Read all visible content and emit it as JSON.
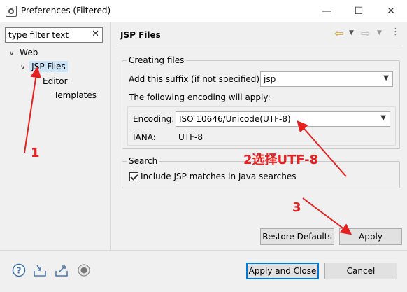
{
  "window": {
    "title": "Preferences (Filtered)",
    "minimize_glyph": "—",
    "maximize_glyph": "☐",
    "close_glyph": "✕"
  },
  "filter": {
    "value": "type filter text",
    "clear_glyph": "✕"
  },
  "tree": {
    "items": [
      {
        "label": "Web",
        "expander": "∨"
      },
      {
        "label": "JSP Files",
        "expander": "∨"
      },
      {
        "label": "Editor",
        "expander": ""
      },
      {
        "label": "Templates",
        "expander": ""
      }
    ]
  },
  "page": {
    "title": "JSP Files",
    "nav_back_icon": "back-arrow-icon",
    "nav_forward_icon": "forward-arrow-icon"
  },
  "creating_files": {
    "group_label": "Creating files",
    "suffix_label": "Add this suffix (if not specified):",
    "suffix_value": "jsp",
    "encoding_intro": "The following encoding will apply:",
    "encoding_label": "Encoding:",
    "encoding_value": "ISO 10646/Unicode(UTF-8)",
    "iana_label": "IANA:",
    "iana_value": "UTF-8"
  },
  "search": {
    "group_label": "Search",
    "include_label": "Include JSP matches in Java searches",
    "include_checked": true
  },
  "buttons": {
    "restore_defaults": "Restore Defaults",
    "apply": "Apply",
    "apply_and_close": "Apply and Close",
    "cancel": "Cancel"
  },
  "footer_icons": [
    "help-icon",
    "import-icon",
    "export-icon",
    "record-icon"
  ],
  "annotations": {
    "step1": "1",
    "step2": "2选择UTF-8",
    "step3": "3",
    "color": "#e52020"
  }
}
